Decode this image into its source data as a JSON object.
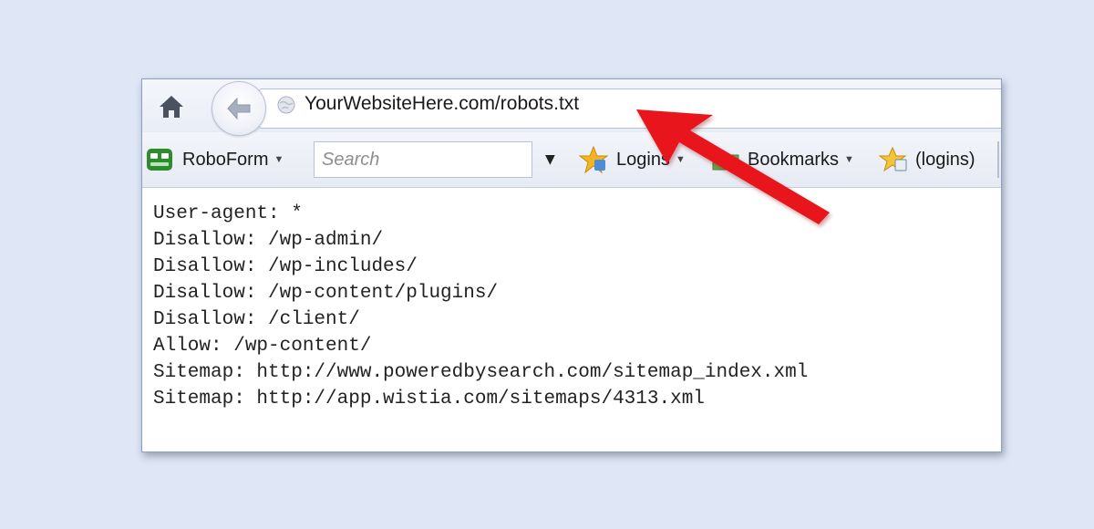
{
  "browser": {
    "url": "YourWebsiteHere.com/robots.txt",
    "icons": {
      "home": "home-icon",
      "back": "back-arrow-icon",
      "site": "globe-icon"
    }
  },
  "toolbar": {
    "roboform_label": "RoboForm",
    "search_placeholder": "Search",
    "logins_label": "Logins",
    "bookmarks_label": "Bookmarks",
    "logins_paren_label": "(logins)"
  },
  "content": {
    "lines": [
      "User-agent: *",
      "Disallow: /wp-admin/",
      "Disallow: /wp-includes/",
      "Disallow: /wp-content/plugins/",
      "Disallow: /client/",
      "Allow: /wp-content/",
      "Sitemap: http://www.poweredbysearch.com/sitemap_index.xml",
      "Sitemap: http://app.wistia.com/sitemaps/4313.xml"
    ]
  },
  "annotation": {
    "arrow_color": "#e8161b",
    "arrow_icon": "red-arrow-icon"
  },
  "colors": {
    "background": "#dfe6f5",
    "window_border": "#8aa0c4"
  }
}
